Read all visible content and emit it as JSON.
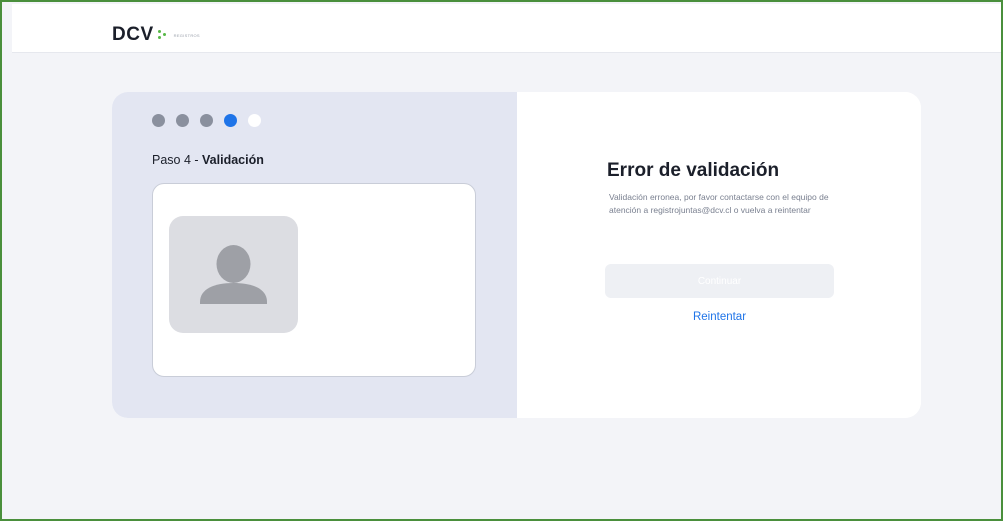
{
  "header": {
    "logo_text": "DCV",
    "logo_subtitle": "REGISTROS"
  },
  "stepper": {
    "total_steps": 5,
    "current_step": 4,
    "step_number_label": "Paso 4 - ",
    "step_name": "Validación"
  },
  "verification": {
    "photo_placeholder_icon": "user-silhouette-icon"
  },
  "error": {
    "title": "Error de validación",
    "description": "Validación erronea, por favor contactarse con el equipo de atención a registrojuntas@dcv.cl o vuelva a reintentar"
  },
  "actions": {
    "continue_label": "Continuar",
    "continue_disabled": true,
    "retry_label": "Reintentar"
  },
  "colors": {
    "frame_border": "#4a8f3c",
    "accent": "#1f74e8",
    "logo_green": "#57b847",
    "left_panel": "#e3e6f2",
    "step_inactive": "#8a909e"
  }
}
